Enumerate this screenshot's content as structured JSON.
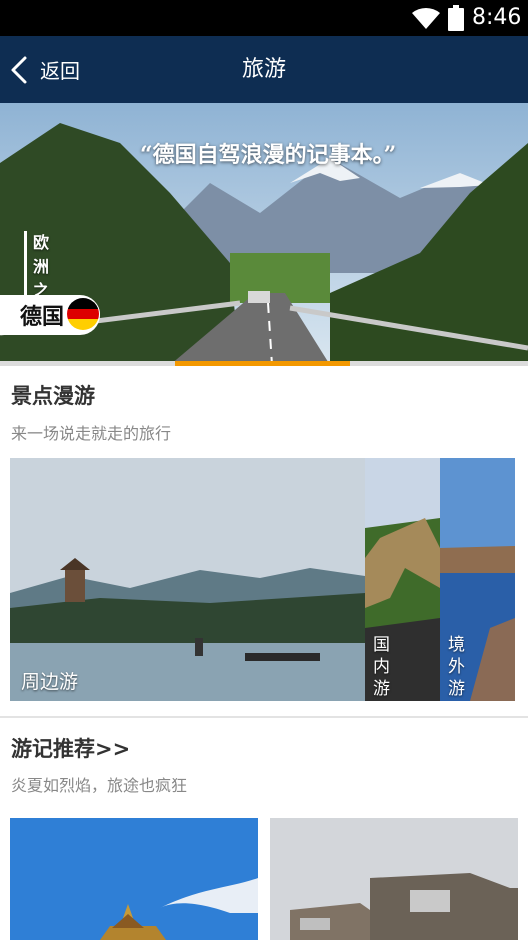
{
  "status_bar": {
    "time": "8:46",
    "icons": [
      "wifi-icon",
      "battery-icon"
    ]
  },
  "app_bar": {
    "back_label": "返回",
    "title": "旅游"
  },
  "banner": {
    "quote": "“德国自驾浪漫的记事本。”",
    "side_text": "欧洲之旅",
    "country": "德国",
    "flag_colors": [
      "#000000",
      "#dd0000",
      "#ffce00"
    ],
    "indicator_color": "#f39800"
  },
  "scenic": {
    "title": "景点漫游",
    "subtitle": "来一场说走就走的旅行",
    "tiles": [
      {
        "label": "周边游"
      },
      {
        "label": "国内游"
      },
      {
        "label": "境外游"
      }
    ]
  },
  "travelogue": {
    "title": "游记推荐>>",
    "subtitle": "炎夏如烈焰，旅途也疯狂"
  },
  "colors": {
    "app_bar": "#0e2d52",
    "accent": "#f39800"
  }
}
